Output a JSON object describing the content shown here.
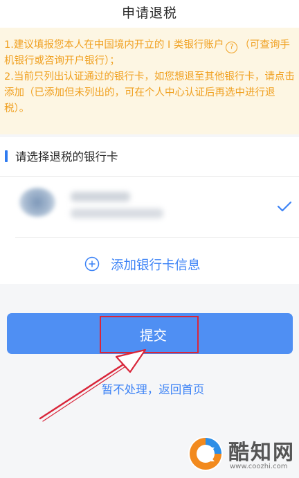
{
  "header": {
    "title": "申请退税"
  },
  "notice": {
    "line1_before_icon": "1.建议填报您本人在中国境内开立的 I 类银行账户",
    "line1_icon": "help-circle-icon",
    "line1_after_icon": "（可查询手机银行或咨询开户银行）；",
    "line2": "2.当前只列出认证通过的银行卡，如您想退至其他银行卡，请点击添加（已添加但未列出的，可在个人中心认证后再选中进行退税）。",
    "color": "#f0a020",
    "background": "#fdf6e3"
  },
  "bank_section": {
    "title": "请选择退税的银行卡",
    "accent_color": "#2f7bf0",
    "selected_card": {
      "logo_icon": "bank-logo-icon",
      "selected": true,
      "check_icon": "checkmark-icon"
    },
    "add_label": "添加银行卡信息",
    "add_icon": "plus-circle-icon"
  },
  "actions": {
    "submit_label": "提交",
    "submit_color": "#4f8ff3",
    "back_label": "暂不处理，返回首页"
  },
  "annotation": {
    "highlight_color": "#d9263a"
  },
  "watermark": {
    "name": "酷知网",
    "url": "www.coozhi.com"
  }
}
